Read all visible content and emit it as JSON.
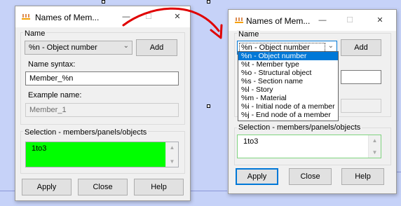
{
  "colors": {
    "selection_bg": "#00ff00",
    "selection_bg_right": "#ffffff",
    "arrow": "#e00000",
    "highlight": "#0078d7"
  },
  "left": {
    "title": "Names of Mem...",
    "controls": [
      "—",
      "☐",
      "✕"
    ],
    "name_label": "Name",
    "combo_value": "%n - Object number",
    "add_label": "Add",
    "syntax_label": "Name syntax:",
    "syntax_value": "Member_%n",
    "example_label": "Example name:",
    "example_value": "Member_1",
    "selection_label": "Selection - members/panels/objects",
    "selection_value": "1to3",
    "apply_label": "Apply",
    "close_label": "Close",
    "help_label": "Help"
  },
  "right": {
    "title": "Names of Mem...",
    "controls": [
      "—",
      "☐",
      "✕"
    ],
    "name_label": "Name",
    "combo_value": "%n - Object number",
    "add_label": "Add",
    "dropdown_items": [
      "%n - Object number",
      "%t - Member type",
      "%o - Structural object",
      "%s - Section name",
      "%l - Story",
      "%m - Material",
      "%i - Initial node of a member",
      "%j - End node of a member"
    ],
    "selected_index": 0,
    "selection_label": "Selection - members/panels/objects",
    "selection_value": "1to3",
    "apply_label": "Apply",
    "close_label": "Close",
    "help_label": "Help"
  }
}
